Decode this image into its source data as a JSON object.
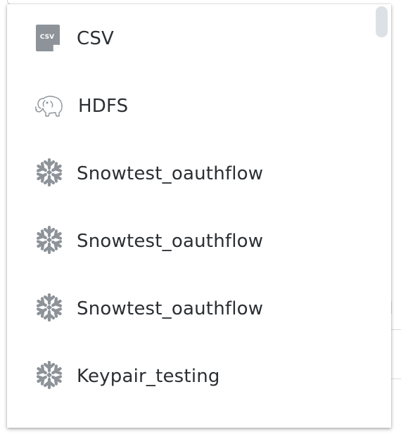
{
  "data_sources": {
    "items": [
      {
        "label": "CSV",
        "icon": "csv-file-icon"
      },
      {
        "label": "HDFS",
        "icon": "hadoop-elephant-icon"
      },
      {
        "label": "Snowtest_oauthflow",
        "icon": "snowflake-icon"
      },
      {
        "label": "Snowtest_oauthflow",
        "icon": "snowflake-icon"
      },
      {
        "label": "Snowtest_oauthflow",
        "icon": "snowflake-icon"
      },
      {
        "label": "Keypair_testing",
        "icon": "snowflake-icon"
      }
    ],
    "csv_icon_text": "CSV"
  },
  "colors": {
    "icon_gray": "#8d9399",
    "text": "#2b2f33",
    "scroll_thumb": "#dce1e6"
  }
}
